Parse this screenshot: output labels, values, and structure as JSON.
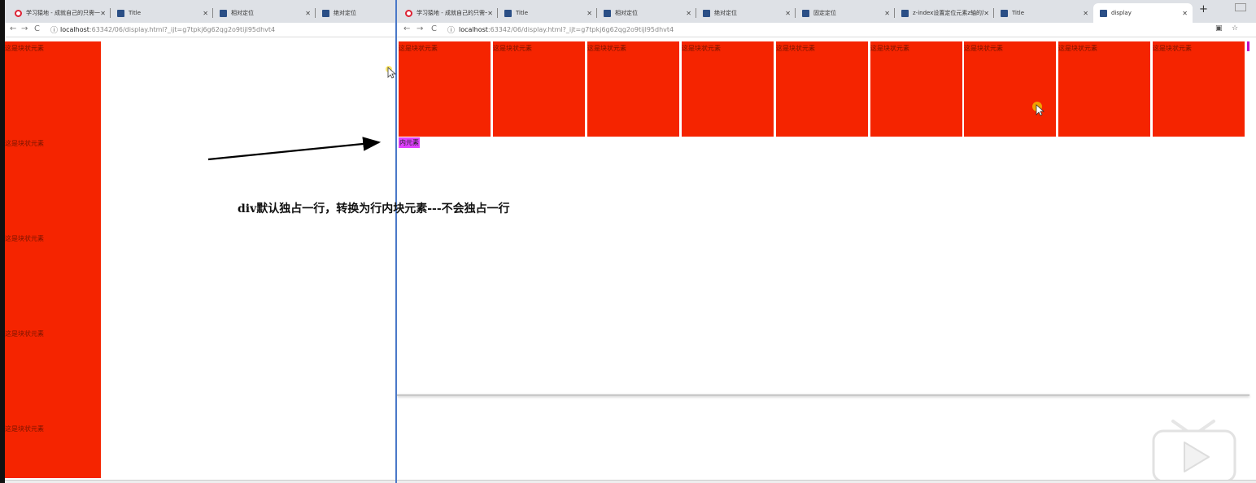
{
  "left_window": {
    "tabs": [
      {
        "label": "学习猿地 - 成就自己的只需一门课",
        "icon": "mooc-icon"
      },
      {
        "label": "Title",
        "icon": "webstorm-icon"
      },
      {
        "label": "相对定位",
        "icon": "webstorm-icon"
      },
      {
        "label": "绝对定位",
        "icon": "webstorm-icon"
      }
    ],
    "address": {
      "host": "localhost",
      "path": ":63342/06/display.html?_ijt=g7tpkj6g62qg2o9tijl95dhvt4"
    },
    "page": {
      "block_divs": [
        "这是块状元素",
        "这是块状元素",
        "这是块状元素",
        "这是块状元素",
        "这是块状元素"
      ]
    }
  },
  "right_window": {
    "tabs": [
      {
        "label": "学习猿地 - 成就自己的只需一门课",
        "icon": "mooc-icon"
      },
      {
        "label": "Title",
        "icon": "webstorm-icon"
      },
      {
        "label": "相对定位",
        "icon": "webstorm-icon"
      },
      {
        "label": "绝对定位",
        "icon": "webstorm-icon"
      },
      {
        "label": "固定定位",
        "icon": "webstorm-icon"
      },
      {
        "label": "z-index设置定位元素z轴的层叠",
        "icon": "webstorm-icon"
      },
      {
        "label": "Title",
        "icon": "webstorm-icon"
      },
      {
        "label": "display",
        "icon": "webstorm-icon",
        "active": true
      }
    ],
    "address": {
      "host": "localhost",
      "path": ":63342/06/display.html?_ijt=g7tpkj6g62qg2o9tijl95dhvt4"
    },
    "page": {
      "inline_block_divs": [
        "这是块状元素",
        "这是块状元素",
        "这是块状元素",
        "这是块状元素",
        "这是块状元素",
        "这是块状元素",
        "这是块状元素",
        "这是块状元素",
        "这是块状元素"
      ],
      "inline_span": "内元素"
    }
  },
  "annotation": "div默认独占一行，转换为行内块元素---不会独占一行",
  "colors": {
    "block_red": "#f52400",
    "inline_magenta": "#e040ff",
    "tabbar_bg": "#dee1e6",
    "split_line": "#4a78c8"
  }
}
